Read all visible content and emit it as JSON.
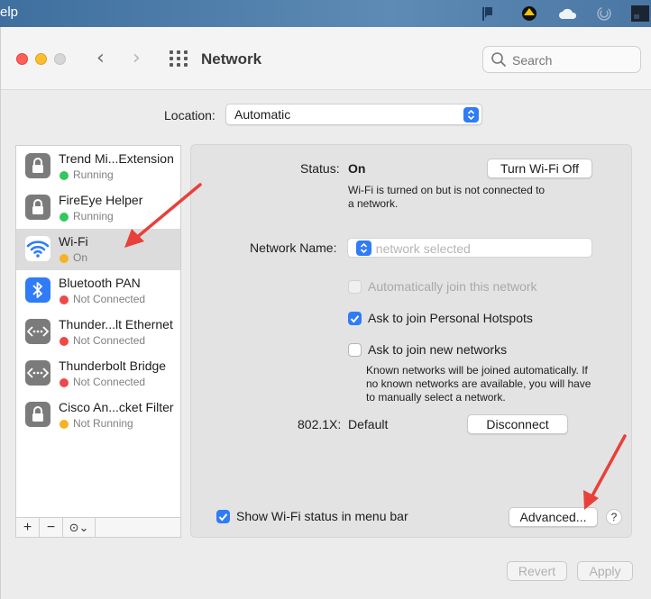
{
  "menubar": {
    "help_fragment": "elp"
  },
  "window": {
    "title": "Network"
  },
  "search": {
    "placeholder": "Search"
  },
  "location": {
    "label": "Location:",
    "value": "Automatic"
  },
  "services": [
    {
      "name": "Trend Mi...Extension",
      "status": "Running",
      "status_color": "#34c759",
      "icon": "lock-icon",
      "selected": false
    },
    {
      "name": "FireEye Helper",
      "status": "Running",
      "status_color": "#34c759",
      "icon": "lock-icon",
      "selected": false
    },
    {
      "name": "Wi-Fi",
      "status": "On",
      "status_color": "#f5b324",
      "icon": "wifi-icon",
      "selected": true
    },
    {
      "name": "Bluetooth PAN",
      "status": "Not Connected",
      "status_color": "#ee4848",
      "icon": "bluetooth-icon",
      "selected": false
    },
    {
      "name": "Thunder...lt Ethernet",
      "status": "Not Connected",
      "status_color": "#ee4848",
      "icon": "ethernet-icon",
      "selected": false
    },
    {
      "name": "Thunderbolt Bridge",
      "status": "Not Connected",
      "status_color": "#ee4848",
      "icon": "ethernet-icon",
      "selected": false
    },
    {
      "name": "Cisco An...cket Filter",
      "status": "Not Running",
      "status_color": "#f5b324",
      "icon": "lock-icon",
      "selected": false
    }
  ],
  "sidebar_toolbar": {
    "add": "+",
    "remove": "−",
    "action": "⊙⌄"
  },
  "detail": {
    "status_label": "Status:",
    "status_value": "On",
    "turn_off_button": "Turn Wi-Fi Off",
    "status_desc_line1": "Wi-Fi is turned on but is not connected to",
    "status_desc_line2": "a network.",
    "network_name_label": "Network Name:",
    "network_name_placeholder": "No network selected",
    "auto_join": {
      "label": "Automatically join this network",
      "checked": false,
      "disabled": true
    },
    "ask_hotspots": {
      "label": "Ask to join Personal Hotspots",
      "checked": true
    },
    "ask_new": {
      "label": "Ask to join new networks",
      "checked": false
    },
    "known_desc_line1": "Known networks will be joined automatically. If",
    "known_desc_line2": "no known networks are available, you will have",
    "known_desc_line3": "to manually select a network.",
    "dot1x_label": "802.1X:",
    "dot1x_value": "Default",
    "disconnect_button": "Disconnect",
    "show_status": {
      "label": "Show Wi-Fi status in menu bar",
      "checked": true
    },
    "advanced_button": "Advanced...",
    "help_button": "?"
  },
  "footer": {
    "revert": "Revert",
    "apply": "Apply"
  },
  "colors": {
    "accent": "#2f7cf6",
    "annotation_arrow": "#e8403a"
  }
}
